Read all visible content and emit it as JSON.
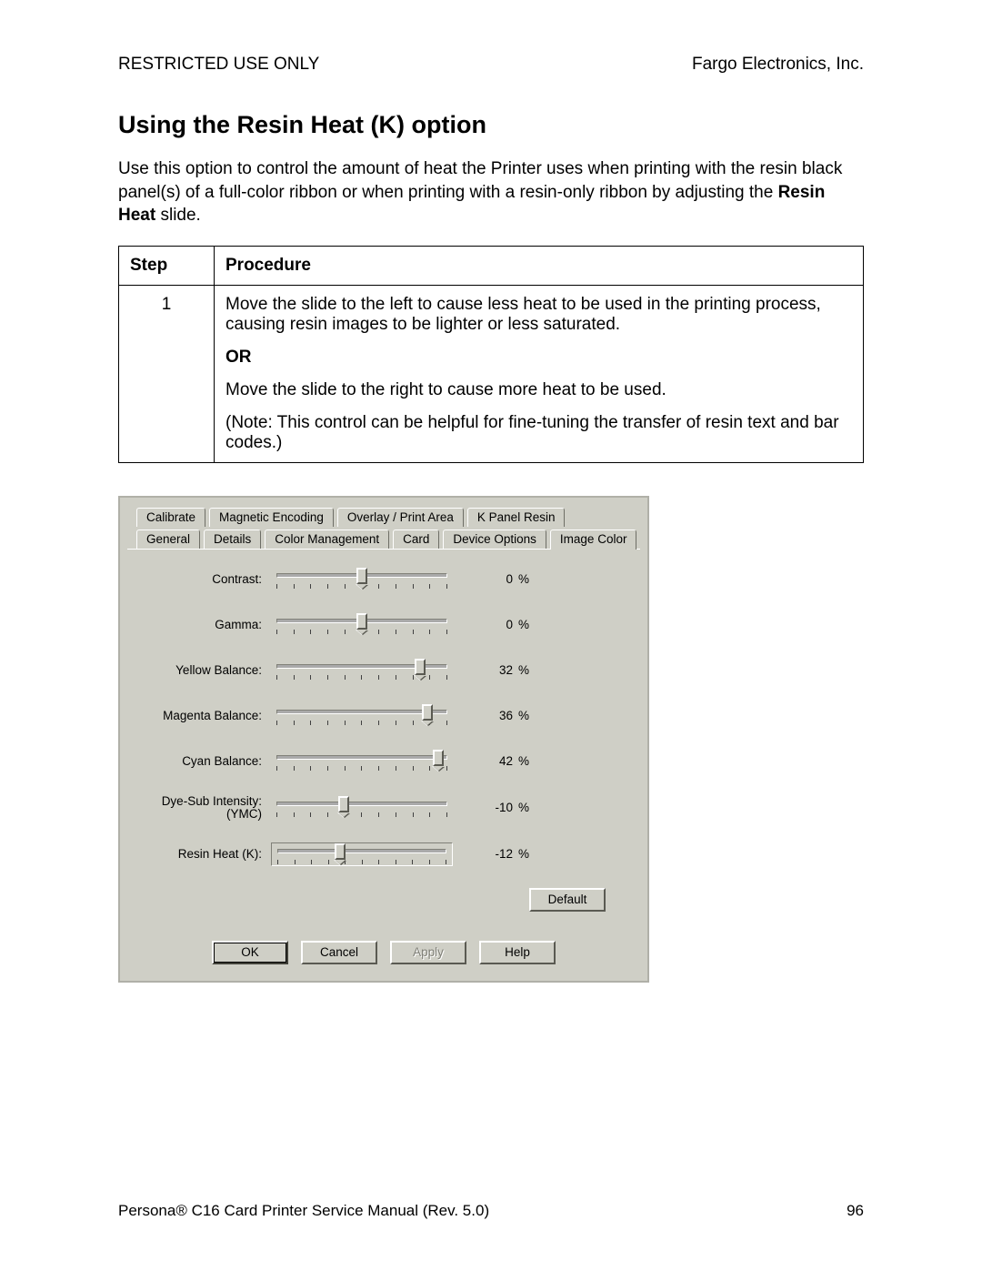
{
  "header": {
    "left": "RESTRICTED USE ONLY",
    "right": "Fargo Electronics, Inc."
  },
  "title": "Using the Resin Heat (K) option",
  "intro": {
    "pre": "Use this option to control the amount of heat the Printer uses when printing with the resin black panel(s) of a full-color ribbon or when printing with a resin-only ribbon by adjusting the ",
    "bold": "Resin Heat",
    "post": " slide."
  },
  "table": {
    "head_step": "Step",
    "head_proc": "Procedure",
    "step": "1",
    "p1": "Move the slide to the left to cause less heat to be used in the printing process, causing resin images to be lighter or less saturated.",
    "or": "OR",
    "p2": "Move the slide to the right to cause more heat to be used.",
    "note_open": "(",
    "note_bold": "Note:",
    "note_rest": "  This control can be helpful for fine-tuning the transfer of resin text and bar codes.)"
  },
  "tabs": {
    "row1": [
      "Calibrate",
      "Magnetic Encoding",
      "Overlay / Print Area",
      "K Panel Resin"
    ],
    "row2": [
      "General",
      "Details",
      "Color Management",
      "Card",
      "Device Options",
      "Image Color"
    ],
    "active": "Image Color"
  },
  "sliders": [
    {
      "label": "Contrast:",
      "value": "0",
      "pos": 50,
      "boxed": false
    },
    {
      "label": "Gamma:",
      "value": "0",
      "pos": 50,
      "boxed": false
    },
    {
      "label": "Yellow Balance:",
      "value": "32",
      "pos": 82,
      "boxed": false
    },
    {
      "label": "Magenta Balance:",
      "value": "36",
      "pos": 86,
      "boxed": false
    },
    {
      "label": "Cyan Balance:",
      "value": "42",
      "pos": 92,
      "boxed": false
    },
    {
      "label": "Dye-Sub Intensity:\n(YMC)",
      "value": "-10",
      "pos": 40,
      "boxed": false
    },
    {
      "label": "Resin Heat  (K):",
      "value": "-12",
      "pos": 38,
      "boxed": true
    }
  ],
  "percent": "%",
  "default_btn": "Default",
  "actions": {
    "ok": "OK",
    "cancel": "Cancel",
    "apply": "Apply",
    "help": "Help"
  },
  "footer": {
    "left": "Persona® C16 Card Printer Service Manual (Rev. 5.0)",
    "right": "96"
  }
}
